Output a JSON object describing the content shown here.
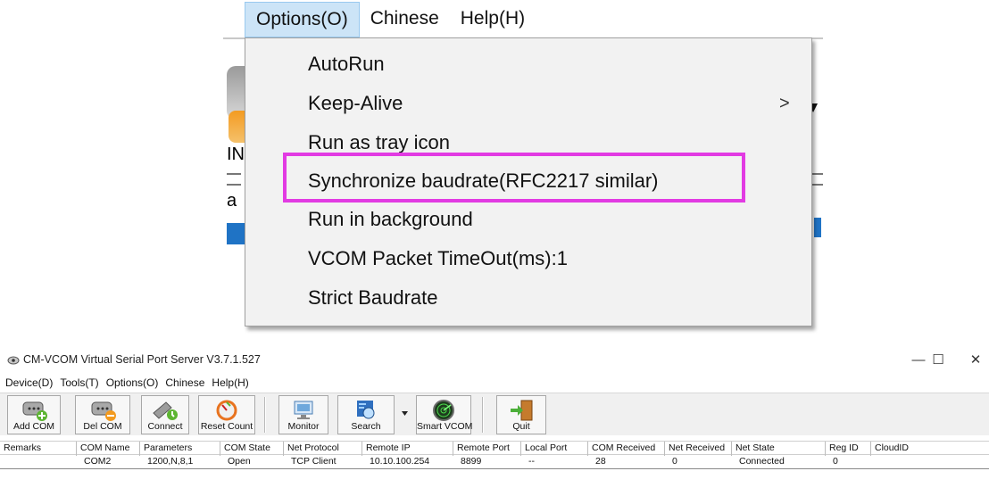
{
  "zoom_inset": {
    "menubar": [
      "Options(O)",
      "Chinese",
      "Help(H)"
    ],
    "active_menu": "Options(O)",
    "background_fragments": [
      "IN",
      "a"
    ],
    "dropdown": [
      {
        "label": "AutoRun",
        "submenu": false
      },
      {
        "label": "Keep-Alive",
        "submenu": true
      },
      {
        "label": "Run as tray icon",
        "submenu": false
      },
      {
        "label": "Synchronize baudrate(RFC2217 similar)",
        "submenu": false,
        "highlighted": true
      },
      {
        "label": "Run in background",
        "submenu": false
      },
      {
        "label": "VCOM Packet TimeOut(ms):1",
        "submenu": false
      },
      {
        "label": "Strict Baudrate",
        "submenu": false
      }
    ],
    "submenu_arrow": ">",
    "highlight_color": "#e23be3",
    "active_color": "#cce4f7"
  },
  "window": {
    "title": "CM-VCOM Virtual Serial Port Server V3.7.1.527",
    "controls": {
      "minimize": "—",
      "maximize": "☐",
      "close": "✕"
    },
    "menubar": [
      "Device(D)",
      "Tools(T)",
      "Options(O)",
      "Chinese",
      "Help(H)"
    ],
    "toolbar": [
      {
        "label": "Add COM",
        "icon": "add-com-icon"
      },
      {
        "label": "Del COM",
        "icon": "del-com-icon"
      },
      {
        "label": "Connect",
        "icon": "connect-icon"
      },
      {
        "label": "Reset Count",
        "icon": "reset-count-icon"
      },
      {
        "label": "Monitor",
        "icon": "monitor-icon"
      },
      {
        "label": "Search",
        "icon": "search-icon"
      },
      {
        "label": "Smart VCOM",
        "icon": "radar-icon"
      },
      {
        "label": "Quit",
        "icon": "quit-icon"
      }
    ],
    "table": {
      "columns": [
        "Remarks",
        "COM Name",
        "Parameters",
        "COM State",
        "Net Protocol",
        "Remote IP",
        "Remote Port",
        "Local Port",
        "COM Received",
        "Net Received",
        "Net State",
        "Reg ID",
        "CloudID"
      ],
      "rows": [
        [
          "",
          "COM2",
          "1200,N,8,1",
          "Open",
          "TCP Client",
          "10.10.100.254",
          "8899",
          "--",
          "28",
          "0",
          "Connected",
          "0",
          ""
        ]
      ]
    }
  }
}
